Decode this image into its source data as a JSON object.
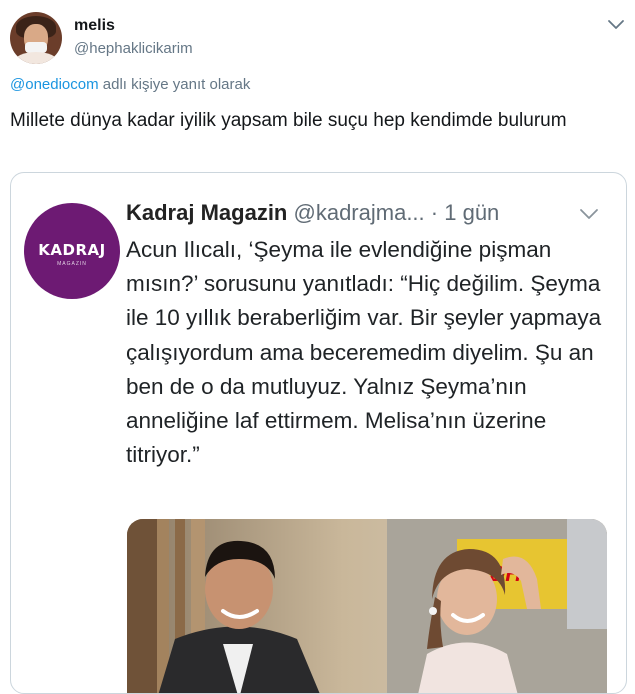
{
  "tweet": {
    "display_name": "melis",
    "handle": "@hephaklicikarim",
    "reply_mention": "@onediocom",
    "reply_suffix": " adlı kişiye yanıt olarak",
    "text": "Millete dünya kadar iyilik yapsam bile suçu hep kendimde bulurum"
  },
  "quoted": {
    "logo_text": "KADRAJ",
    "logo_sub": "MAGAZIN",
    "name": "Kadraj Magazin",
    "handle": "@kadrajma...",
    "separator": "·",
    "time": "1 gün",
    "text": "Acun Ilıcalı, ‘Şeyma ile evlendiğine pişman mısın?’ sorusunu yanıtladı: “Hiç değilim. Şeyma ile 10 yıllık beraberliğim var. Bir şeyler yapmaya çalışıyordum ama beceremedim diyelim. Şu an ben de o da mutluyuz. Yalnız Şeyma’nın anneliğine laf ettirmem. Melisa’nın üzerine titriyor.”",
    "photo_sign_text": "DHL"
  },
  "colors": {
    "link": "#1b95e0",
    "secondary": "#657786",
    "logo_purple": "#6d1a73",
    "border": "#ccd6dd"
  },
  "icons": {
    "tweet_menu": "chevron-down-icon",
    "quoted_menu": "chevron-down-icon"
  }
}
